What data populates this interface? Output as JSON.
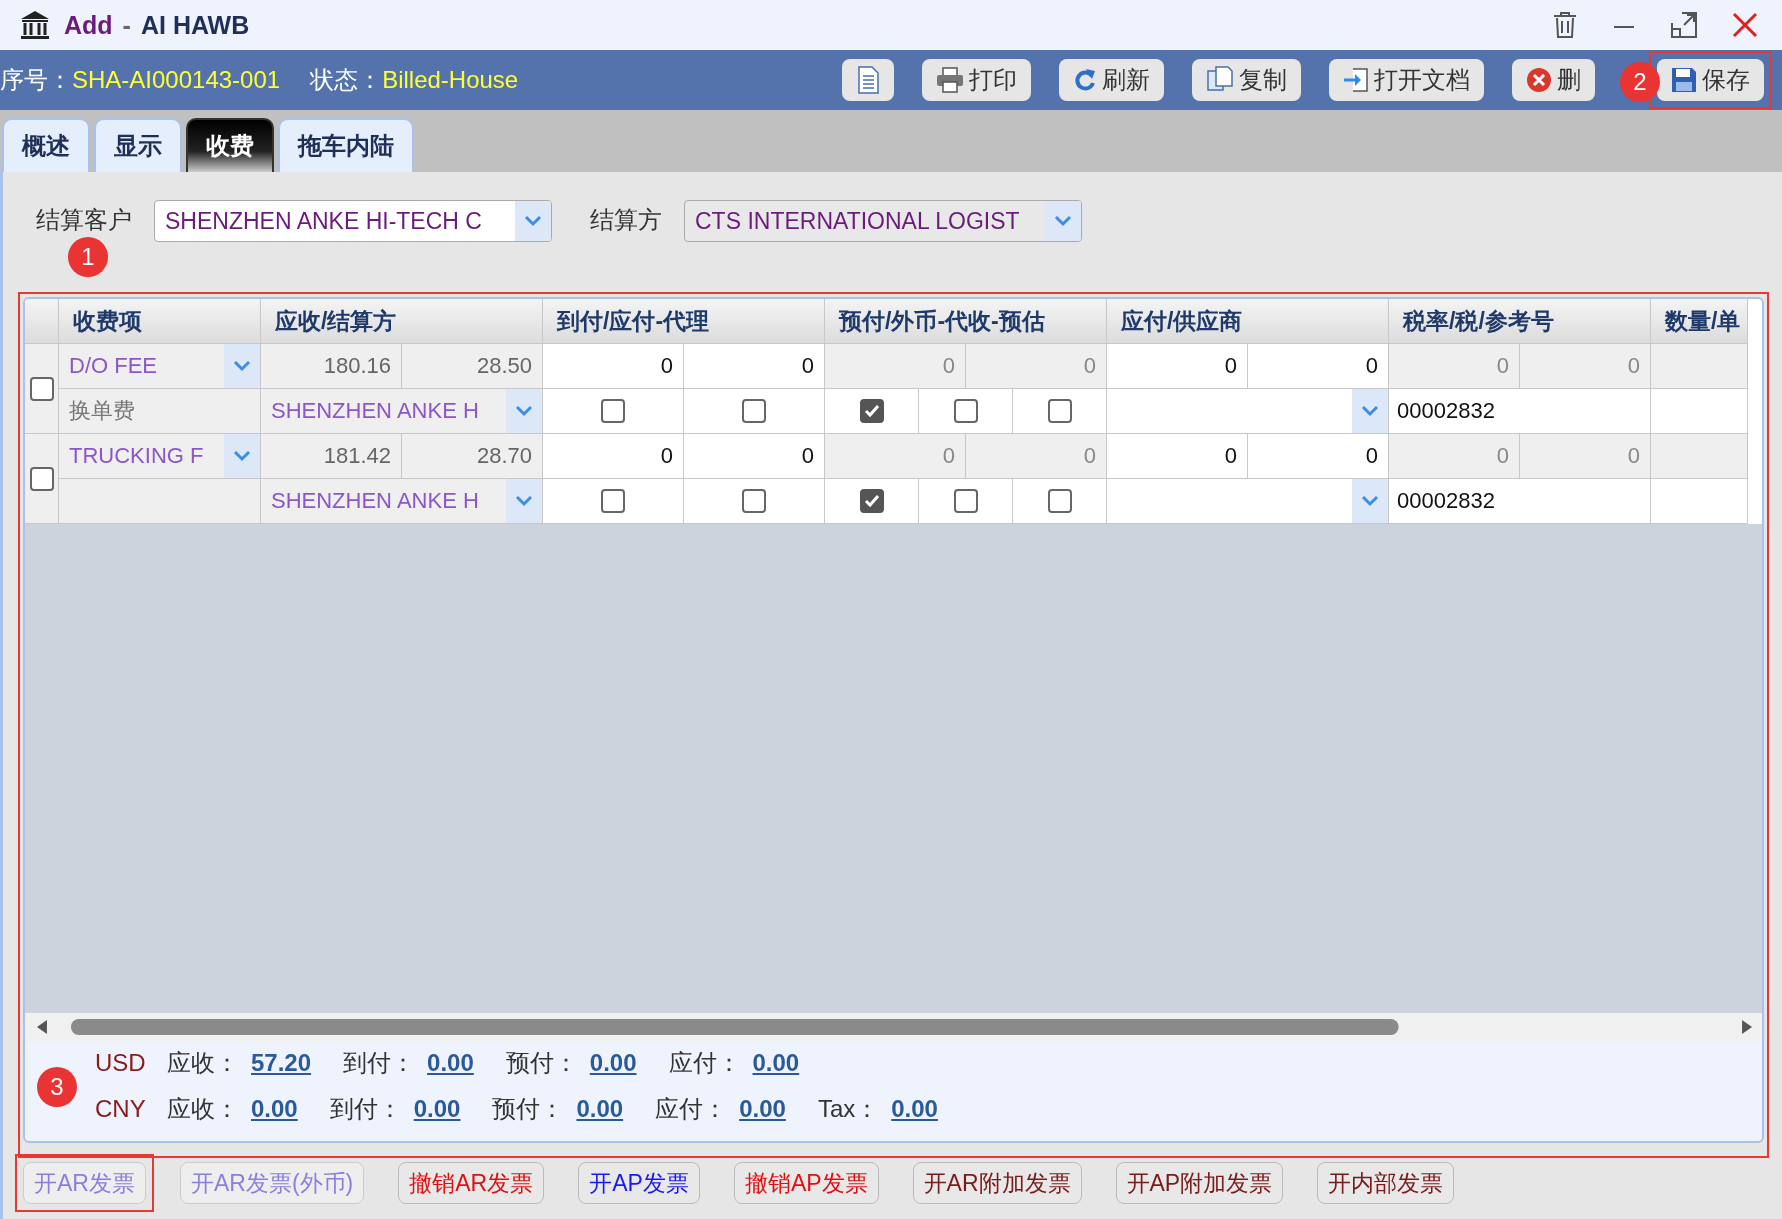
{
  "window": {
    "action": "Add",
    "separator": "-",
    "title": "AI HAWB"
  },
  "toolbar": {
    "fields": [
      {
        "label": "序号：",
        "value": "SHA-AI000143-001"
      },
      {
        "label": "状态：",
        "value": "Billed-House"
      }
    ],
    "buttons": [
      {
        "kind": "document",
        "highlighted": false
      },
      {
        "kind": "print",
        "label": "打印",
        "highlighted": false
      },
      {
        "kind": "refresh",
        "label": "刷新",
        "highlighted": false
      },
      {
        "kind": "copy",
        "label": "复制",
        "highlighted": false
      },
      {
        "kind": "open",
        "label": "打开文档",
        "highlighted": false
      },
      {
        "kind": "delete",
        "label": "删",
        "highlighted": false
      },
      {
        "kind": "save",
        "label": "保存",
        "highlighted": true
      }
    ]
  },
  "tabs": [
    {
      "label": "概述",
      "selected": false
    },
    {
      "label": "显示",
      "selected": false
    },
    {
      "label": "收费",
      "selected": true
    },
    {
      "label": "拖车内陆",
      "selected": false
    }
  ],
  "form": [
    {
      "label": "结算客户",
      "value": "SHENZHEN ANKE HI-TECH C",
      "disabled": false
    },
    {
      "label": "结算方",
      "value": "CTS INTERNATIONAL LOGIST",
      "disabled": true
    }
  ],
  "grid": {
    "highlighted": true,
    "columns": [
      "收费项",
      "应收/结算方",
      "到付/应付-代理",
      "预付/外币-代收-预估",
      "应付/供应商",
      "税率/税/参考号",
      "数量/单"
    ],
    "rows": [
      {
        "checked": false,
        "item": "D/O FEE",
        "item_cn": "换单费",
        "amounts": [
          "180.16",
          "28.50"
        ],
        "party": "SHENZHEN ANKE H",
        "collect": [
          "0",
          "0"
        ],
        "collect_checks": [
          false,
          false
        ],
        "prepaid": [
          "0",
          "0"
        ],
        "prepaid_checks": [
          true,
          false,
          false
        ],
        "payable": [
          "0",
          "0"
        ],
        "tax": [
          "0",
          "0"
        ],
        "ref": "00002832"
      },
      {
        "checked": false,
        "item": "TRUCKING F",
        "amounts": [
          "181.42",
          "28.70"
        ],
        "party": "SHENZHEN ANKE H",
        "collect": [
          "0",
          "0"
        ],
        "collect_checks": [
          false,
          false
        ],
        "prepaid": [
          "0",
          "0"
        ],
        "prepaid_checks": [
          true,
          false,
          false
        ],
        "payable": [
          "0",
          "0"
        ],
        "tax": [
          "0",
          "0"
        ],
        "ref": "00002832"
      }
    ]
  },
  "totals": [
    {
      "currency": "USD",
      "items": [
        {
          "label": "应收：",
          "value": "57.20"
        },
        {
          "label": "到付：",
          "value": "0.00"
        },
        {
          "label": "预付：",
          "value": "0.00"
        },
        {
          "label": "应付：",
          "value": "0.00"
        }
      ]
    },
    {
      "currency": "CNY",
      "items": [
        {
          "label": "应收：",
          "value": "0.00"
        },
        {
          "label": "到付：",
          "value": "0.00"
        },
        {
          "label": "预付：",
          "value": "0.00"
        },
        {
          "label": "应付：",
          "value": "0.00"
        },
        {
          "label": "Tax：",
          "value": "0.00"
        }
      ]
    }
  ],
  "actions": [
    {
      "label": "开AR发票",
      "kind": "muted",
      "highlighted": true
    },
    {
      "label": "开AR发票(外币)",
      "kind": "muted",
      "highlighted": false
    },
    {
      "label": "撤销AR发票",
      "kind": "cancel",
      "highlighted": false
    },
    {
      "label": "开AP发票",
      "kind": "primary",
      "highlighted": false
    },
    {
      "label": "撤销AP发票",
      "kind": "cancel",
      "highlighted": false
    },
    {
      "label": "开AR附加发票",
      "kind": "normal",
      "highlighted": false
    },
    {
      "label": "开AP附加发票",
      "kind": "normal",
      "highlighted": false
    },
    {
      "label": "开内部发票",
      "kind": "normal",
      "highlighted": false
    }
  ],
  "annotations": [
    {
      "label": "1"
    },
    {
      "label": "2"
    },
    {
      "label": "3"
    }
  ]
}
